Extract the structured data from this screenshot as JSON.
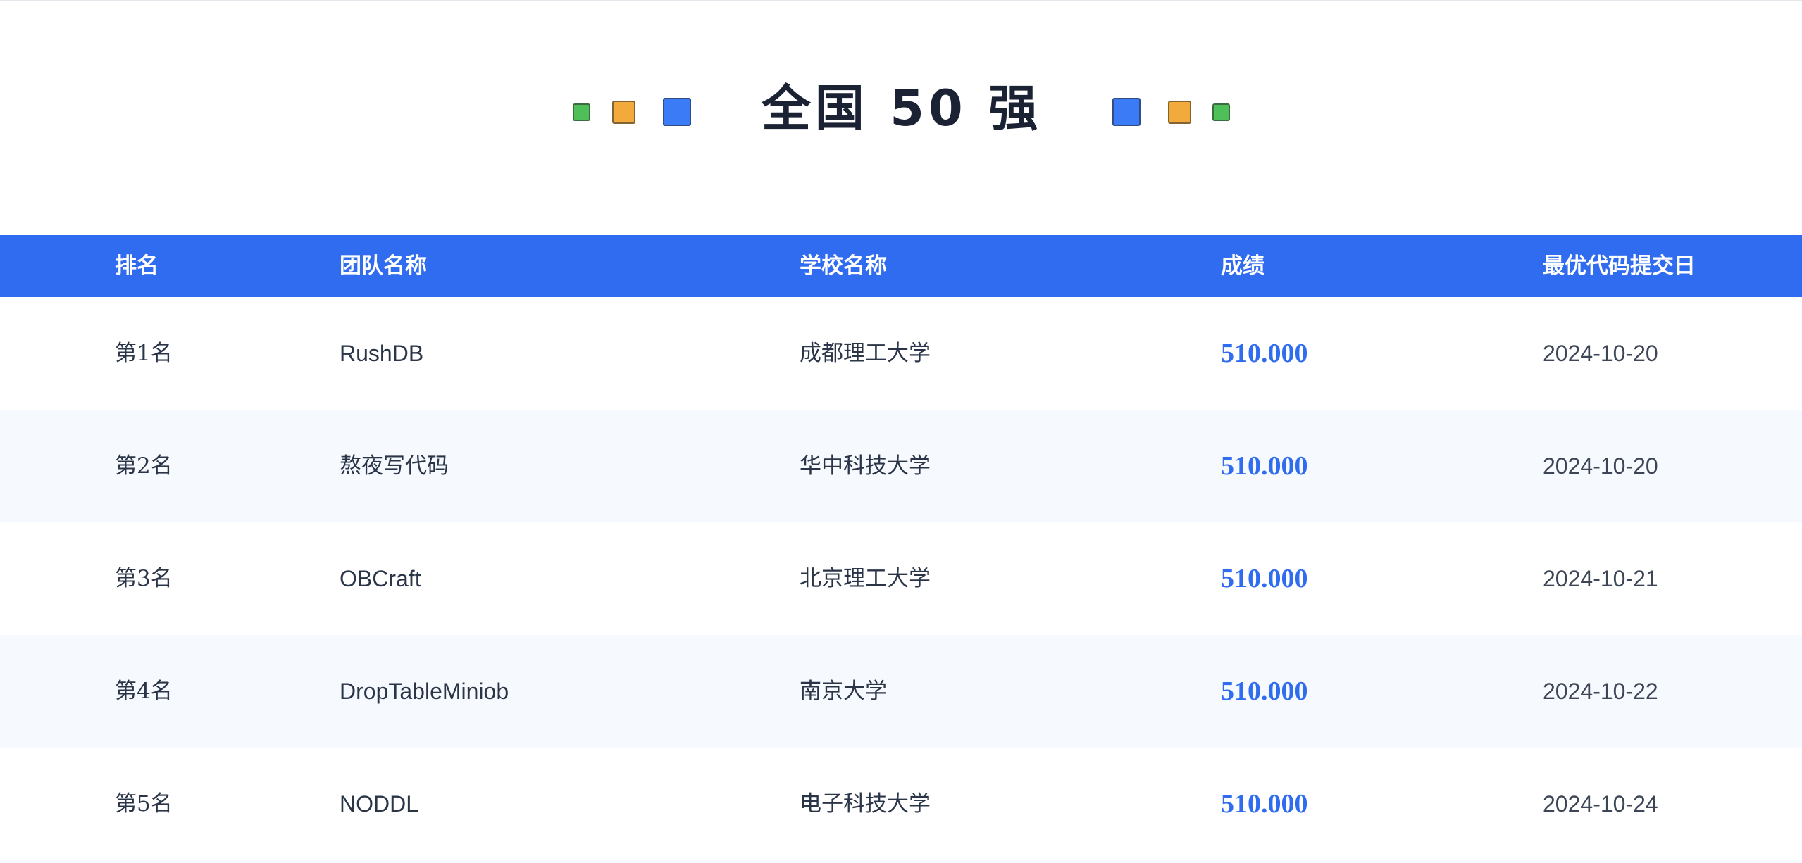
{
  "title": "全国 50 强",
  "colors": {
    "accent": "#306cef",
    "green": "#4fbf5a",
    "orange": "#f2aa3c",
    "blue": "#3b7cf6",
    "row_alt": "#f6f9fd"
  },
  "decorations": {
    "left_squares": [
      "green",
      "orange",
      "blue"
    ],
    "right_squares": [
      "blue",
      "orange",
      "green"
    ]
  },
  "table": {
    "headers": {
      "rank": "排名",
      "team": "团队名称",
      "school": "学校名称",
      "score": "成绩",
      "date": "最优代码提交日"
    },
    "rows": [
      {
        "rank": "第1名",
        "team": "RushDB",
        "school": "成都理工大学",
        "score": "510.000",
        "date": "2024-10-20"
      },
      {
        "rank": "第2名",
        "team": "熬夜写代码",
        "school": "华中科技大学",
        "score": "510.000",
        "date": "2024-10-20"
      },
      {
        "rank": "第3名",
        "team": "OBCraft",
        "school": "北京理工大学",
        "score": "510.000",
        "date": "2024-10-21"
      },
      {
        "rank": "第4名",
        "team": "DropTableMiniob",
        "school": "南京大学",
        "score": "510.000",
        "date": "2024-10-22"
      },
      {
        "rank": "第5名",
        "team": "NODDL",
        "school": "电子科技大学",
        "score": "510.000",
        "date": "2024-10-24"
      }
    ]
  }
}
